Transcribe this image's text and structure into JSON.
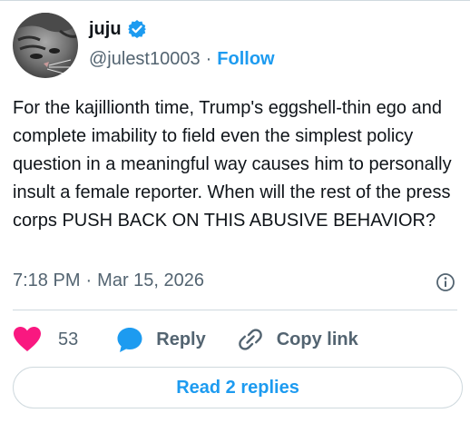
{
  "user": {
    "display_name": "juju",
    "handle": "@julest10003",
    "separator": "·",
    "follow_label": "Follow",
    "avatar_icon": "cat-avatar"
  },
  "tweet": {
    "text": "For the kajillionth time, Trump's eggshell-thin ego and complete imability to field even the simplest policy question in a meaningful way causes him to personally insult a female reporter. When will the rest of the press corps PUSH BACK ON THIS ABUSIVE BEHAVIOR?",
    "time": "7:18 PM",
    "separator": "·",
    "date": "Mar 15, 2026"
  },
  "actions": {
    "like_count": "53",
    "reply_label": "Reply",
    "copy_link_label": "Copy link"
  },
  "read_replies_label": "Read 2 replies",
  "colors": {
    "accent": "#1d9bf0",
    "like": "#f91880",
    "muted": "#536471",
    "text": "#0f1419",
    "border": "#cfd9de"
  }
}
